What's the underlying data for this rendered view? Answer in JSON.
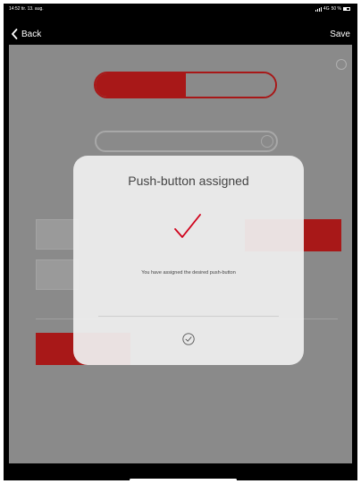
{
  "status_bar": {
    "time_date": "14:52  tir. 13. aug.",
    "network": "4G",
    "battery": "50 %"
  },
  "nav": {
    "back_label": "Back",
    "save_label": "Save"
  },
  "dialog": {
    "title": "Push-button assigned",
    "message": "You have assigned the desired push-button"
  },
  "icons": {
    "back": "chevron-left-icon",
    "check": "checkmark-icon",
    "confirm": "circle-check-icon"
  },
  "colors": {
    "accent": "#d0021b",
    "dim_accent": "#a81818",
    "overlay": "#8a8a8a"
  }
}
